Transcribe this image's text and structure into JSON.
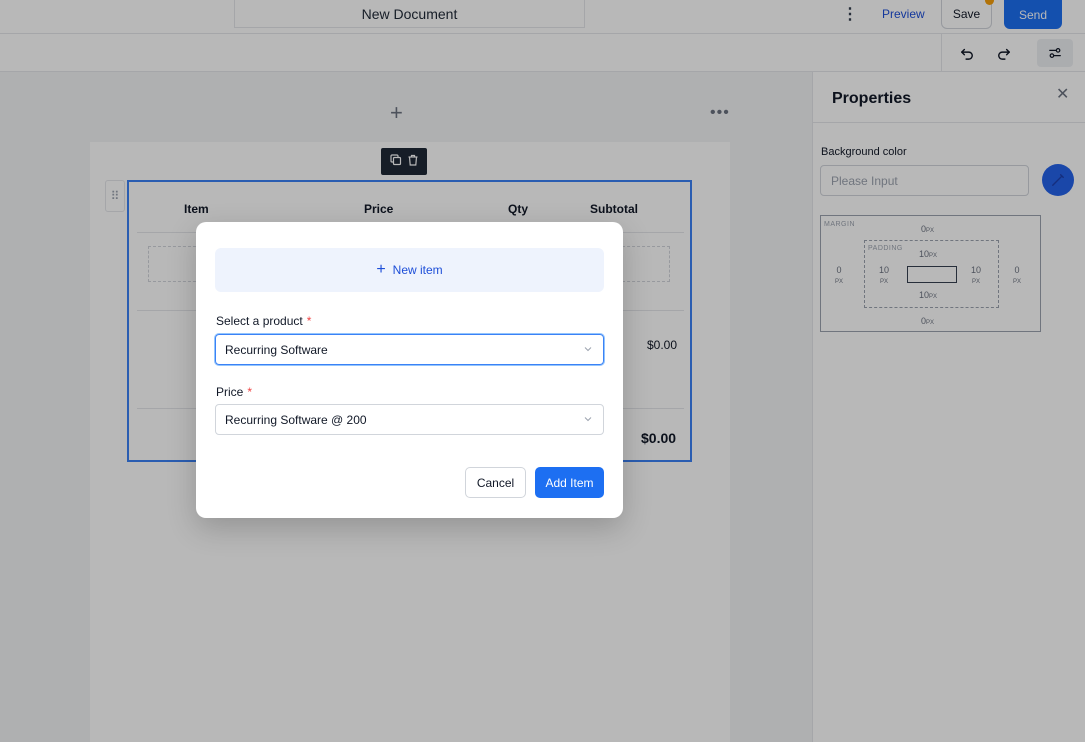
{
  "header": {
    "doc_title": "New Document",
    "preview_label": "Preview",
    "save_label": "Save",
    "send_label": "Send"
  },
  "table": {
    "col_item": "Item",
    "col_price": "Price",
    "col_qty": "Qty",
    "col_subtotal": "Subtotal",
    "row_subtotal": "$0.00",
    "total": "$0.00"
  },
  "properties": {
    "title": "Properties",
    "bg_label": "Background color",
    "bg_placeholder": "Please Input",
    "margin_label": "MARGIN",
    "padding_label": "PADDING",
    "margin": {
      "top": "0",
      "right": "0",
      "bottom": "0",
      "left": "0"
    },
    "padding": {
      "top": "10",
      "right": "10",
      "bottom": "10",
      "left": "10"
    },
    "unit": "PX"
  },
  "modal": {
    "new_item_label": "New item",
    "product_label": "Select a product",
    "product_value": "Recurring Software",
    "price_label": "Price",
    "price_value": "Recurring Software @ 200",
    "cancel_label": "Cancel",
    "add_label": "Add Item",
    "required_mark": "*"
  },
  "colors": {
    "primary": "#1d6ff2",
    "accent_dot": "#f59e0b",
    "selection": "#3b82f6"
  }
}
